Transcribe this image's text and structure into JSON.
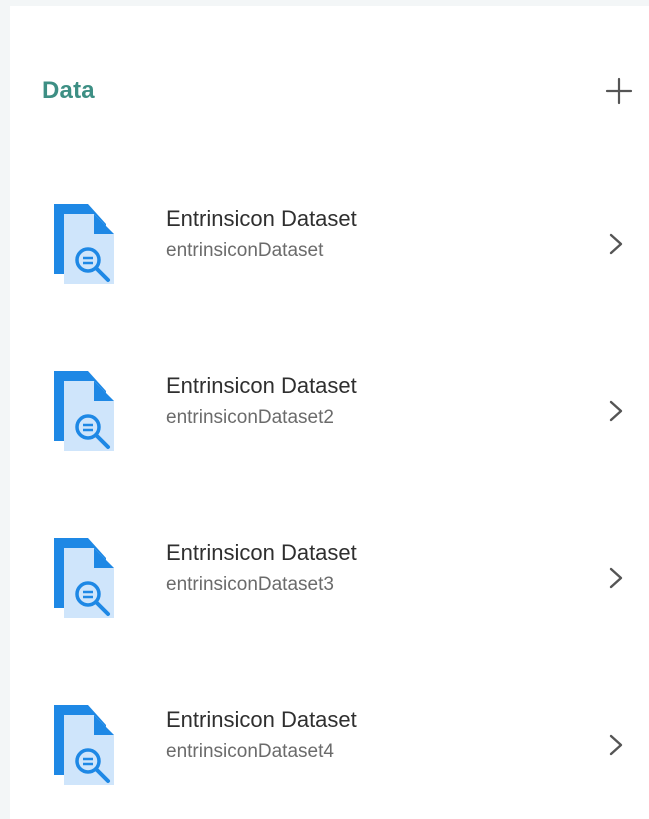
{
  "header": {
    "title": "Data",
    "add_icon": "plus-icon"
  },
  "datasets": [
    {
      "title": "Entrinsicon Dataset",
      "subtitle": "entrinsiconDataset",
      "icon": "dataset-search-icon"
    },
    {
      "title": "Entrinsicon Dataset",
      "subtitle": "entrinsiconDataset2",
      "icon": "dataset-search-icon"
    },
    {
      "title": "Entrinsicon Dataset",
      "subtitle": "entrinsiconDataset3",
      "icon": "dataset-search-icon"
    },
    {
      "title": "Entrinsicon Dataset",
      "subtitle": "entrinsiconDataset4",
      "icon": "dataset-search-icon"
    }
  ],
  "colors": {
    "accent": "#3d8f84",
    "icon_blue": "#1e88e5",
    "icon_light_blue": "#cfe5fb",
    "title_text": "#2f2f2f",
    "subtitle_text": "#6b6b6b"
  }
}
